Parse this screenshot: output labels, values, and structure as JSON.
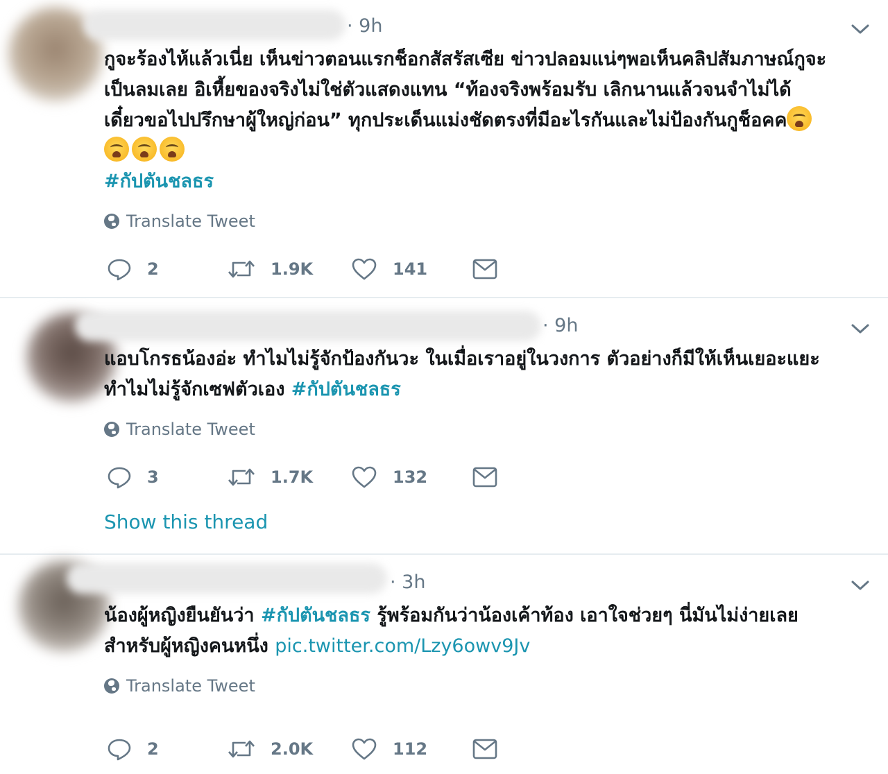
{
  "tweets": [
    {
      "time": "· 9h",
      "lines": [
        "กูจะร้องไห้แล้วเนี่ย เห็นข่าวตอนแรกช็อกสัสรัสเซีย ข่าวปลอมแน่ๆพอเห็นคลิปสัมภาษณ์กูจะ",
        "เป็นลมเลย อิเหี้ยของจริงไม่ใช่ตัวแสดงแทน “ท้องจริงพร้อมรับ เลิกนานแล้วจนจำไม่ได้",
        "เดี๋ยวขอไปปรึกษาผู้ใหญ่ก่อน” ทุกประเด็นแม่งชัดตรงที่มีอะไรกันและไม่ป้องกันกูช็อคค"
      ],
      "hashtag": "#กัปตันชลธร",
      "translate": "Translate Tweet",
      "replies": "2",
      "retweets": "1.9K",
      "likes": "141"
    },
    {
      "time": "· 9h",
      "lines": [
        "แอบโกรธน้องอ่ะ ทำไมไม่รู้จักป้องกันวะ ในเมื่อเราอยู่ในวงการ ตัวอย่างก็มีให้เห็นเยอะแยะ",
        "ทำไมไม่รู้จักเซฟตัวเอง"
      ],
      "hashtag": "#กัปตันชลธร",
      "translate": "Translate Tweet",
      "replies": "3",
      "retweets": "1.7K",
      "likes": "132",
      "show_thread": "Show this thread"
    },
    {
      "time": "· 3h",
      "line1_before": "น้องผู้หญิงยืนยันว่า",
      "hashtag": "#กัปตันชลธร",
      "line1_after": "รู้พร้อมกันว่าน้องเค้าท้อง เอาใจช่วยๆ นี่มันไม่ง่ายเลย",
      "line2": "สำหรับผู้หญิงคนหนึ่ง",
      "link": "pic.twitter.com/Lzy6owv9Jv",
      "translate": "Translate Tweet",
      "replies": "2",
      "retweets": "2.0K",
      "likes": "112"
    }
  ],
  "icons": {
    "reply": "reply-icon",
    "retweet": "retweet-icon",
    "like": "like-icon",
    "message": "message-icon",
    "caret": "chevron-down-icon",
    "translate": "globe-icon",
    "emoji": "crying-face-emoji"
  },
  "colors": {
    "hashtag": "#1b95b0",
    "muted": "#657786",
    "text": "#14171a",
    "divider": "#e6ecf0"
  }
}
